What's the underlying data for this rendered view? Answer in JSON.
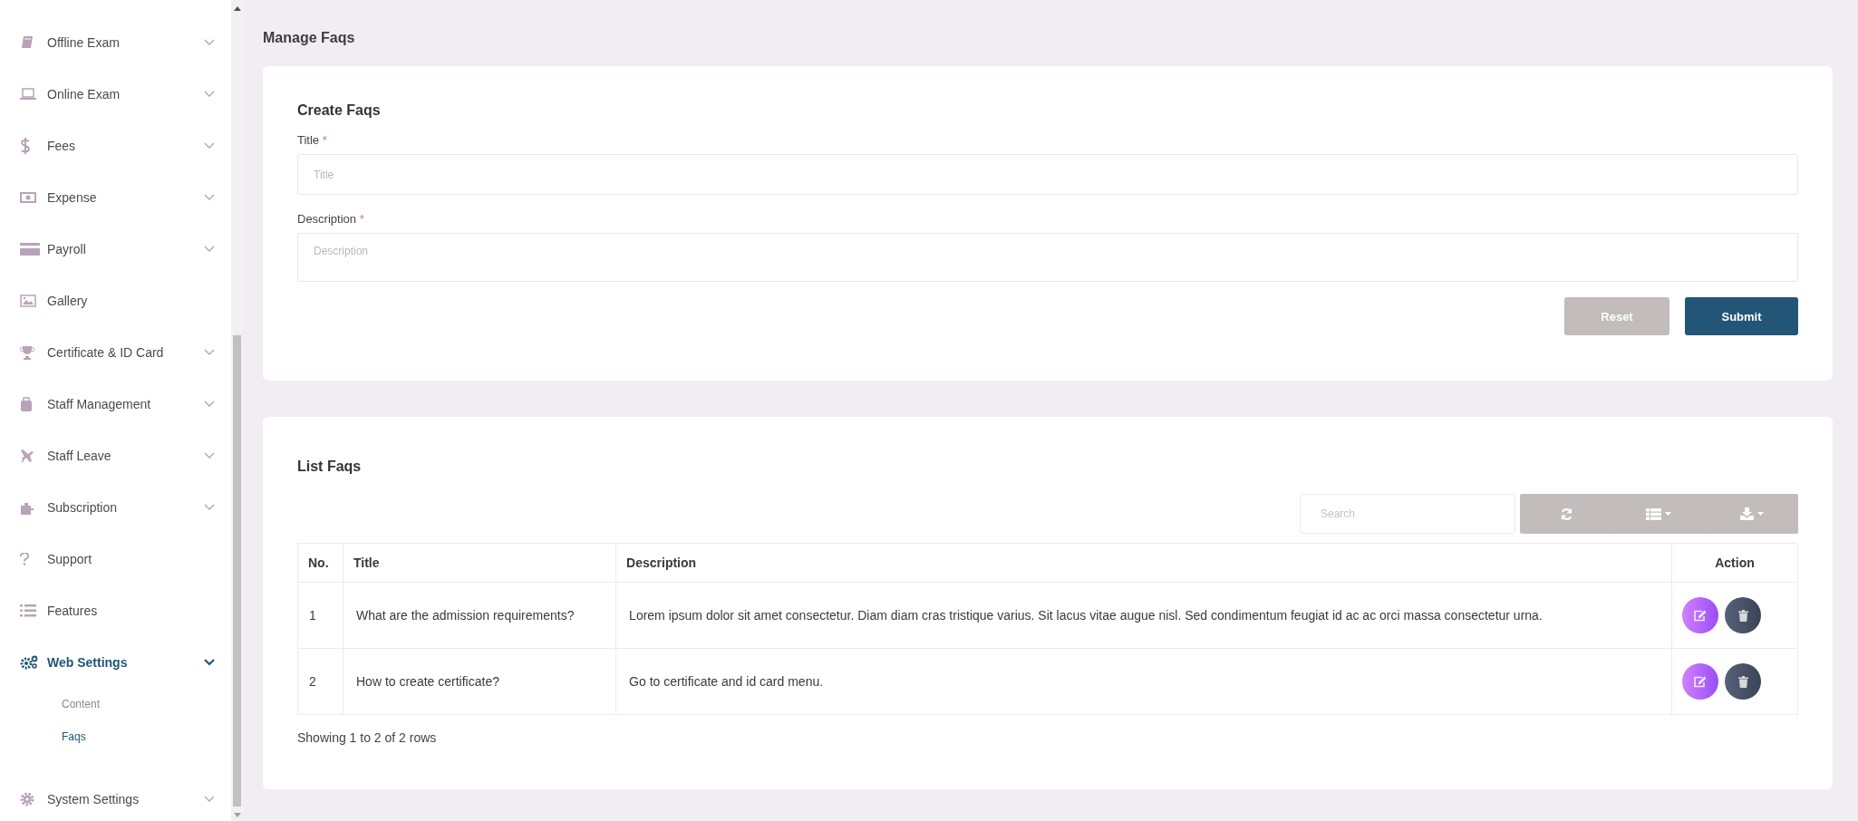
{
  "sidebar": {
    "items": [
      {
        "label": "Offline Exam",
        "expanded": false,
        "selected": false
      },
      {
        "label": "Online Exam",
        "expanded": false,
        "selected": false
      },
      {
        "label": "Fees",
        "expanded": false,
        "selected": false
      },
      {
        "label": "Expense",
        "expanded": false,
        "selected": false
      },
      {
        "label": "Payroll",
        "expanded": false,
        "selected": false
      },
      {
        "label": "Gallery",
        "selected": false
      },
      {
        "label": "Certificate & ID Card",
        "expanded": false,
        "selected": false
      },
      {
        "label": "Staff Management",
        "expanded": false,
        "selected": false
      },
      {
        "label": "Staff Leave",
        "expanded": false,
        "selected": false
      },
      {
        "label": "Subscription",
        "expanded": false,
        "selected": false
      },
      {
        "label": "Support",
        "selected": false
      },
      {
        "label": "Features",
        "selected": false
      },
      {
        "label": "Web Settings",
        "expanded": true,
        "selected": true,
        "children": [
          {
            "label": "Content",
            "selected": false
          },
          {
            "label": "Faqs",
            "selected": true
          }
        ]
      },
      {
        "label": "System Settings",
        "expanded": false,
        "selected": false
      }
    ]
  },
  "page_title": "Manage Faqs",
  "create_form": {
    "title": "Create Faqs",
    "fields": [
      {
        "kind": "input",
        "label": "Title",
        "required_mark": "*",
        "placeholder": "Title"
      },
      {
        "kind": "textarea",
        "label": "Description",
        "required_mark": "*",
        "placeholder": "Description"
      }
    ],
    "buttons": [
      {
        "kind": "secondary",
        "label": "Reset"
      },
      {
        "kind": "primary",
        "label": "Submit"
      }
    ]
  },
  "list": {
    "title": "List Faqs",
    "search": {
      "placeholder": "Search"
    },
    "table": {
      "columns": [
        "No.",
        "Title",
        "Description",
        "Action"
      ],
      "rows": [
        {
          "no": "1",
          "title": "What are the admission requirements?",
          "description": "Lorem ipsum dolor sit amet consectetur. Diam diam cras tristique varius. Sit lacus vitae augue nisl. Sed condimentum feugiat id ac ac orci massa consectetur urna."
        },
        {
          "no": "2",
          "title": "How to create certificate?",
          "description": "Go to certificate and id card menu."
        }
      ]
    },
    "footer": "Showing 1 to 2 of 2 rows"
  }
}
